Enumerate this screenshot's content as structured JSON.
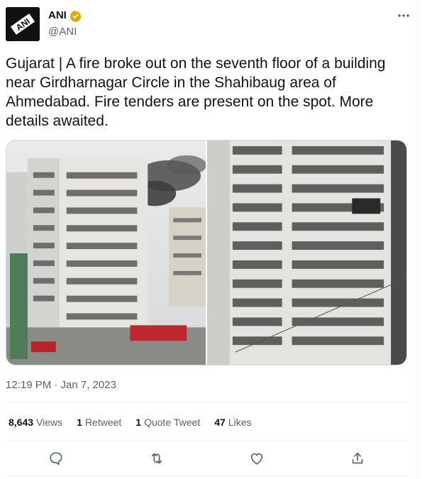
{
  "author": {
    "name": "ANI",
    "handle": "@ANI",
    "avatar_text": "ANI",
    "avatar_icon": "ani-logo-icon",
    "verified_icon": "verified-badge-icon",
    "verified_color": "#d9a900"
  },
  "more_icon": "more-icon",
  "tweet_text": "Gujarat | A fire broke out on the seventh floor of a building near Girdharnagar Circle in the Shahibaug area of Ahmedabad. Fire tenders are present on the spot. More details awaited.",
  "media": [
    {
      "icon": "fire-building-photo-1"
    },
    {
      "icon": "fire-building-photo-2"
    }
  ],
  "timestamp": "12:19 PM · Jan 7, 2023",
  "stats": {
    "views_count": "8,643",
    "views_label": "Views",
    "retweets_count": "1",
    "retweets_label": "Retweet",
    "quotes_count": "1",
    "quotes_label": "Quote Tweet",
    "likes_count": "47",
    "likes_label": "Likes"
  },
  "actions": [
    {
      "icon": "reply-icon"
    },
    {
      "icon": "retweet-icon"
    },
    {
      "icon": "like-icon"
    },
    {
      "icon": "share-icon"
    }
  ],
  "colors": {
    "text": "#0f1419",
    "secondary": "#536471",
    "border": "#eff3f4"
  }
}
